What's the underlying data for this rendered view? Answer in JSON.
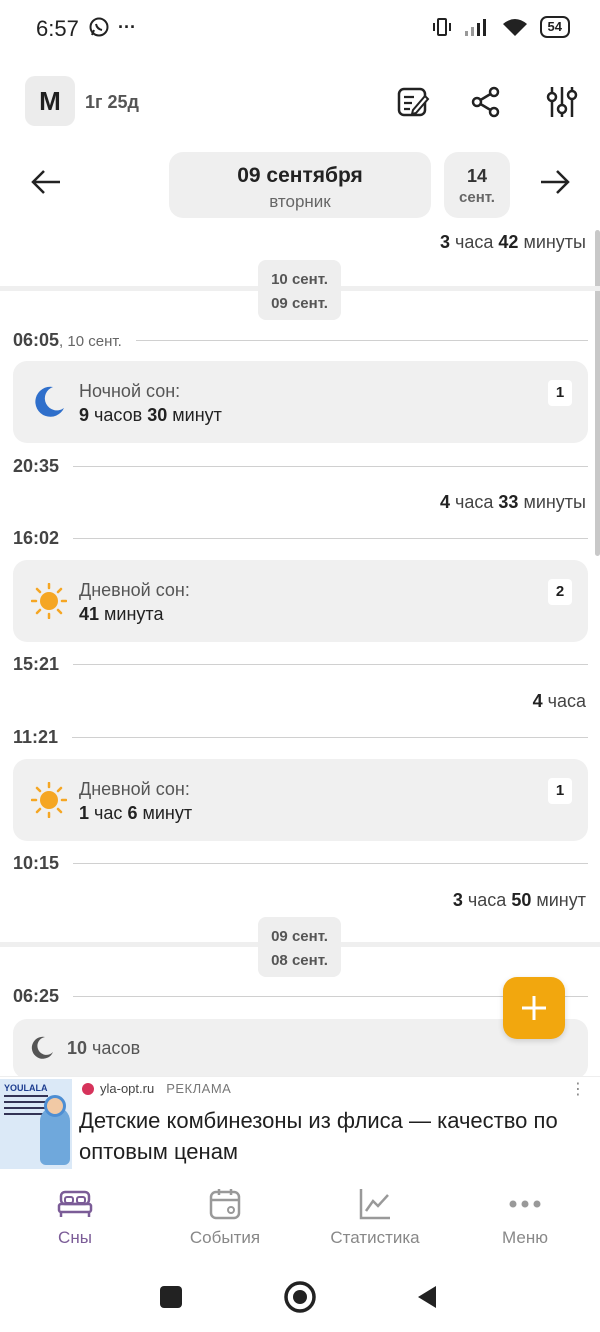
{
  "status": {
    "time": "6:57",
    "dots": "···",
    "battery": "54"
  },
  "top": {
    "avatar_letter": "M",
    "age": "1г 25д"
  },
  "date_nav": {
    "day": "09 сентября",
    "weekday": "вторник",
    "next_day": "14",
    "next_month": "сент."
  },
  "timeline": {
    "dur1": {
      "h": "3",
      "h_unit": "часа",
      "m": "42",
      "m_unit": "минуты"
    },
    "sep1": {
      "top": "10 сент.",
      "bottom": "09 сент."
    },
    "t1": {
      "time": "06:05",
      "suffix": ", 10 сент."
    },
    "card1": {
      "label": "Ночной сон:",
      "h": "9",
      "h_unit": "часов",
      "m": "30",
      "m_unit": "минут",
      "badge": "1"
    },
    "t2": "20:35",
    "dur2": {
      "h": "4",
      "h_unit": "часа",
      "m": "33",
      "m_unit": "минуты"
    },
    "t3": "16:02",
    "card2": {
      "label": "Дневной сон:",
      "m": "41",
      "m_unit": "минута",
      "badge": "2"
    },
    "t4": "15:21",
    "dur3": {
      "h": "4",
      "h_unit": "часа"
    },
    "t5": "11:21",
    "card3": {
      "label": "Дневной сон:",
      "h": "1",
      "h_unit": "час",
      "m": "6",
      "m_unit": "минут",
      "badge": "1"
    },
    "t6": "10:15",
    "dur4": {
      "h": "3",
      "h_unit": "часа",
      "m": "50",
      "m_unit": "минут"
    },
    "sep2": {
      "top": "09 сент.",
      "bottom": "08 сент."
    },
    "t7": "06:25",
    "card4": {
      "h": "10",
      "h_unit": "часов"
    }
  },
  "ad": {
    "thumb_brand": "YOULALA",
    "source": "yla-opt.ru",
    "tag": "РЕКЛАМА",
    "more": "⋮",
    "title": "Детские комбинезоны из флиса — качество по оптовым ценам"
  },
  "nav": [
    {
      "label": "Сны",
      "icon": "bed-icon"
    },
    {
      "label": "События",
      "icon": "calendar-icon"
    },
    {
      "label": "Статистика",
      "icon": "chart-icon"
    },
    {
      "label": "Меню",
      "icon": "dots-icon"
    }
  ],
  "colors": {
    "accent": "#f2a70e",
    "moon": "#2f6fcb",
    "sun": "#f5a623",
    "nav_active": "#7b5c97"
  }
}
